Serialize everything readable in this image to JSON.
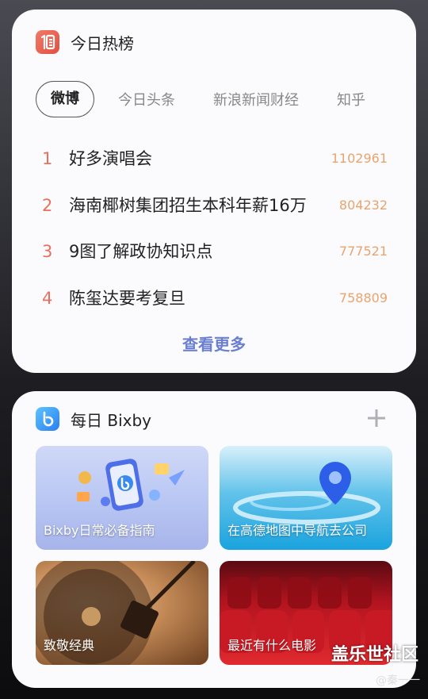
{
  "hot_list": {
    "title": "今日热榜",
    "icon": "hot-list-icon",
    "tabs": [
      "微博",
      "今日头条",
      "新浪新闻财经",
      "知乎"
    ],
    "active_tab": "微博",
    "items": [
      {
        "rank": "1",
        "title": "好多演唱会",
        "count": "1102961"
      },
      {
        "rank": "2",
        "title": "海南椰树集团招生本科年薪16万",
        "count": "804232"
      },
      {
        "rank": "3",
        "title": "9图了解政协知识点",
        "count": "777521"
      },
      {
        "rank": "4",
        "title": "陈玺达要考复旦",
        "count": "758809"
      }
    ],
    "more_label": "查看更多"
  },
  "bixby": {
    "title": "每日 Bixby",
    "icon": "bixby-icon",
    "tiles": [
      {
        "label": "Bixby日常必备指南"
      },
      {
        "label": "在高德地图中导航去公司"
      },
      {
        "label": "致敬经典"
      },
      {
        "label": "最近有什么电影"
      }
    ]
  },
  "watermark": {
    "text": "盖乐世社区",
    "sub": "@秦一一"
  },
  "colors": {
    "rank_number": "#e8705e",
    "count": "#e8a46e",
    "more_link": "#6b7fd1"
  }
}
